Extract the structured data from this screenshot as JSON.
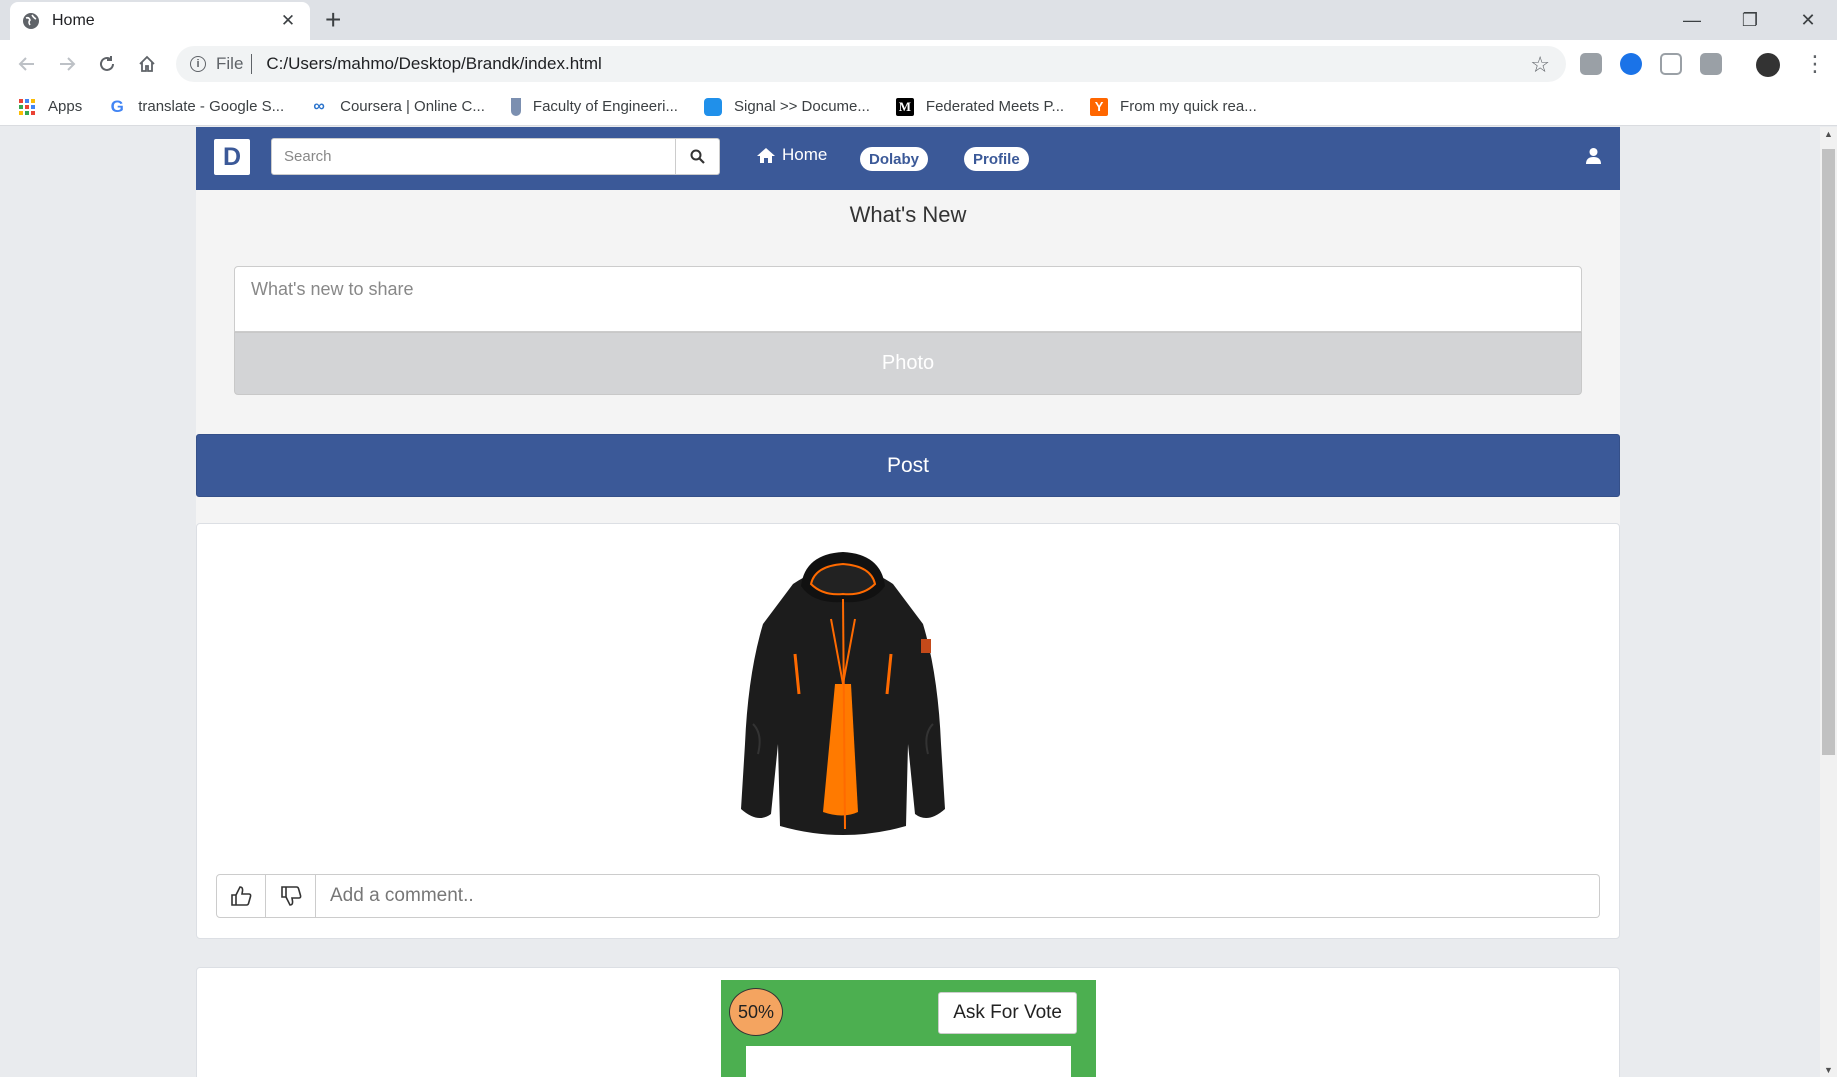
{
  "browser": {
    "tab_title": "Home",
    "tab_close": "✕",
    "new_tab": "+",
    "url_prefix": "File",
    "url": "C:/Users/mahmo/Desktop/Brandk/index.html",
    "window_controls": {
      "minimize": "—",
      "maximize": "❐",
      "close": "✕"
    },
    "bookmarks": [
      {
        "label": "Apps",
        "icon": "apps-grid-icon"
      },
      {
        "label": "translate - Google S...",
        "icon": "google-icon"
      },
      {
        "label": "Coursera | Online C...",
        "icon": "coursera-icon"
      },
      {
        "label": "Faculty of Engineeri...",
        "icon": "faculty-icon"
      },
      {
        "label": "Signal >> Docume...",
        "icon": "signal-icon"
      },
      {
        "label": "Federated Meets P...",
        "icon": "medium-icon",
        "glyph": "M"
      },
      {
        "label": "From my quick rea...",
        "icon": "ycombinator-icon",
        "glyph": "Y"
      }
    ]
  },
  "site": {
    "brand": "D",
    "search_placeholder": "Search",
    "nav_home": "Home",
    "nav_pills": [
      "Dolaby",
      "Profile"
    ],
    "colors": {
      "primary": "#3b5998",
      "vote_green": "#4caf50",
      "badge_orange": "#f4a460"
    }
  },
  "composer": {
    "title": "What's New",
    "share_placeholder": "What's new to share",
    "photo_label": "Photo",
    "post_label": "Post"
  },
  "post1": {
    "image": "black-jacket-orange-lining",
    "comment_placeholder": "Add a comment.."
  },
  "post2": {
    "percent": "50%",
    "ask_vote_label": "Ask For Vote"
  }
}
